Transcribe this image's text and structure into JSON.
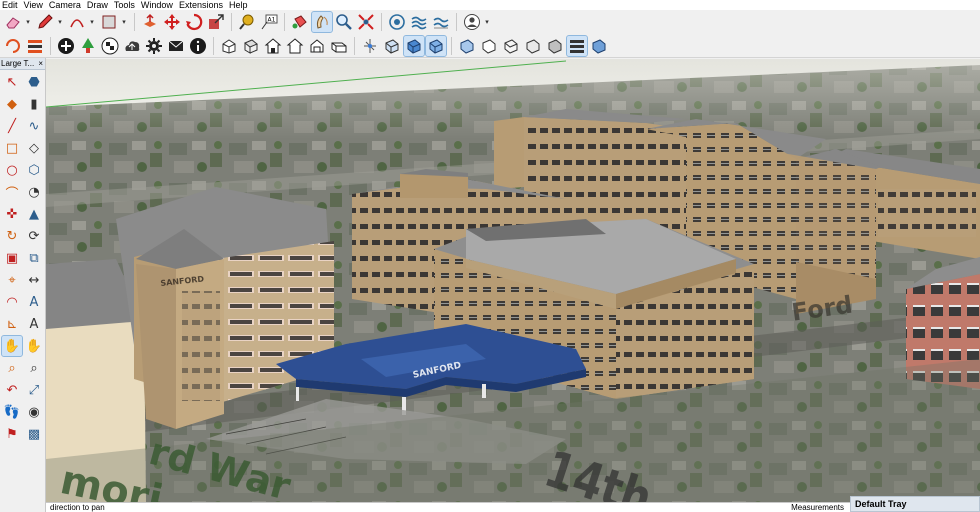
{
  "menu": [
    "Edit",
    "View",
    "Camera",
    "Draw",
    "Tools",
    "Window",
    "Extensions",
    "Help"
  ],
  "toolbar1": [
    "eraser-icon",
    "pencil-icon",
    "arc-icon",
    "rectangle-icon",
    "push-pull-icon",
    "move-icon",
    "rotate-icon",
    "scale-icon",
    "tape-measure-icon",
    "text-icon",
    "paint-bucket-icon",
    "orbit-icon",
    "zoom-icon",
    "zoom-extents-icon",
    "geo-location-icon",
    "sandbox-icon",
    "sandbox-smoove-icon",
    "user-account-icon"
  ],
  "toolbar2": [
    "section-cut-icon",
    "add-location-icon",
    "plus-icon",
    "tree-icon",
    "checker-icon",
    "upload-icon",
    "gear-icon",
    "mail-icon",
    "info-icon",
    "iso-view-icon",
    "top-view-icon",
    "front-view-icon",
    "right-view-icon",
    "back-view-icon",
    "left-view-icon",
    "xray-icon",
    "back-edges-icon",
    "wireframe-icon",
    "hidden-line-icon",
    "shaded-icon",
    "shaded-textures-icon",
    "monochrome-icon"
  ],
  "left_panel": {
    "title": "Large T...",
    "close": "×",
    "tools": [
      "select-icon",
      "make-component-icon",
      "paint-bucket-icon",
      "eraser-icon",
      "line-icon",
      "freehand-icon",
      "rectangle-icon",
      "rotated-rectangle-icon",
      "circle-icon",
      "polygon-icon",
      "arc-icon",
      "pie-icon",
      "move-icon",
      "push-pull-icon",
      "rotate-icon",
      "follow-me-icon",
      "scale-icon",
      "offset-icon",
      "tape-measure-icon",
      "dimension-icon",
      "protractor-icon",
      "text-icon",
      "axes-icon",
      "3d-text-icon",
      "orbit-icon",
      "pan-icon",
      "zoom-icon",
      "zoom-window-icon",
      "previous-icon",
      "zoom-extents-icon",
      "walk-icon",
      "look-around-icon",
      "position-camera-icon",
      "section-plane-icon"
    ]
  },
  "scene": {
    "building_sign_left": "SANFORD",
    "canopy_sign": "SANFORD",
    "map_labels": [
      "Ford",
      "rd War",
      "mori",
      "14th"
    ]
  },
  "status": {
    "text": "direction to pan",
    "measurements": "Measurements"
  },
  "tray": {
    "title": "Default Tray"
  },
  "colors": {
    "canopy": "#2e4f93",
    "brick": "#b79c74",
    "roof": "#858585",
    "axis_green": "#4fb04f"
  }
}
